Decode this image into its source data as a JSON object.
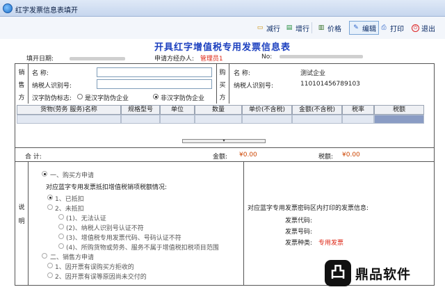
{
  "window": {
    "title": "红字发票信息表填开"
  },
  "toolbar": {
    "reduce_row": "减行",
    "add_row": "增行",
    "price": "价格",
    "edit": "编辑",
    "print": "打印",
    "exit": "退出"
  },
  "doc": {
    "title": "开具红字增值税专用发票信息表"
  },
  "meta": {
    "fill_date_label": "填开日期:",
    "applicant_label": "申请方经办人:",
    "applicant_value": "管理员1",
    "no_label": "No:"
  },
  "seller": {
    "side_label": [
      "销",
      "售",
      "方"
    ],
    "name_label": "名      称:",
    "taxid_label": "纳税人识别号:",
    "anti_label": "汉字防伪标志:",
    "anti_opt1": "是汉字防伪企业",
    "anti_opt2": "非汉字防伪企业",
    "name_value": "",
    "taxid_value": ""
  },
  "buyer": {
    "side_label": [
      "购",
      "买",
      "方"
    ],
    "name_label": "名      称:",
    "name_value": "测试企业",
    "taxid_label": "纳税人识别号:",
    "taxid_value": "110101456789103"
  },
  "table": {
    "columns": [
      "货物(劳务 服务)名称",
      "规格型号",
      "单位",
      "数量",
      "单价(不含税)",
      "金额(不含税)",
      "税率",
      "税额"
    ]
  },
  "totals": {
    "sum_label": "合    计:",
    "amount_label": "金额:",
    "amount_value": "¥0.00",
    "tax_label": "税额:",
    "tax_value": "¥0.00"
  },
  "notes": {
    "side_label": [
      "说",
      "明"
    ],
    "buyer_apply": "一、购买方申请",
    "deduct_q": "对应蓝字专用发票抵扣增值税销项税额情况:",
    "deducted": "1、已抵扣",
    "not_deducted": "2、未抵扣",
    "sub1": "(1)、无法认证",
    "sub2": "(2)、纳税人识别号认证不符",
    "sub3": "(3)、增值税专用发票代码、号码认证不符",
    "sub4": "(4)、所购货物或劳务、服务不属于增值税扣税项目范围",
    "seller_apply": "二、销售方申请",
    "s1": "1、因开票有误购买方拒收的",
    "s2": "2、因开票有误等原因尚未交付的",
    "right_title": "对应蓝字专用发票密码区内打印的发票信息:",
    "code_label": "发票代码:",
    "number_label": "发票号码:",
    "kind_label": "发票种类:",
    "kind_value": "专用发票"
  },
  "watermark": {
    "text": "鼎品软件"
  }
}
